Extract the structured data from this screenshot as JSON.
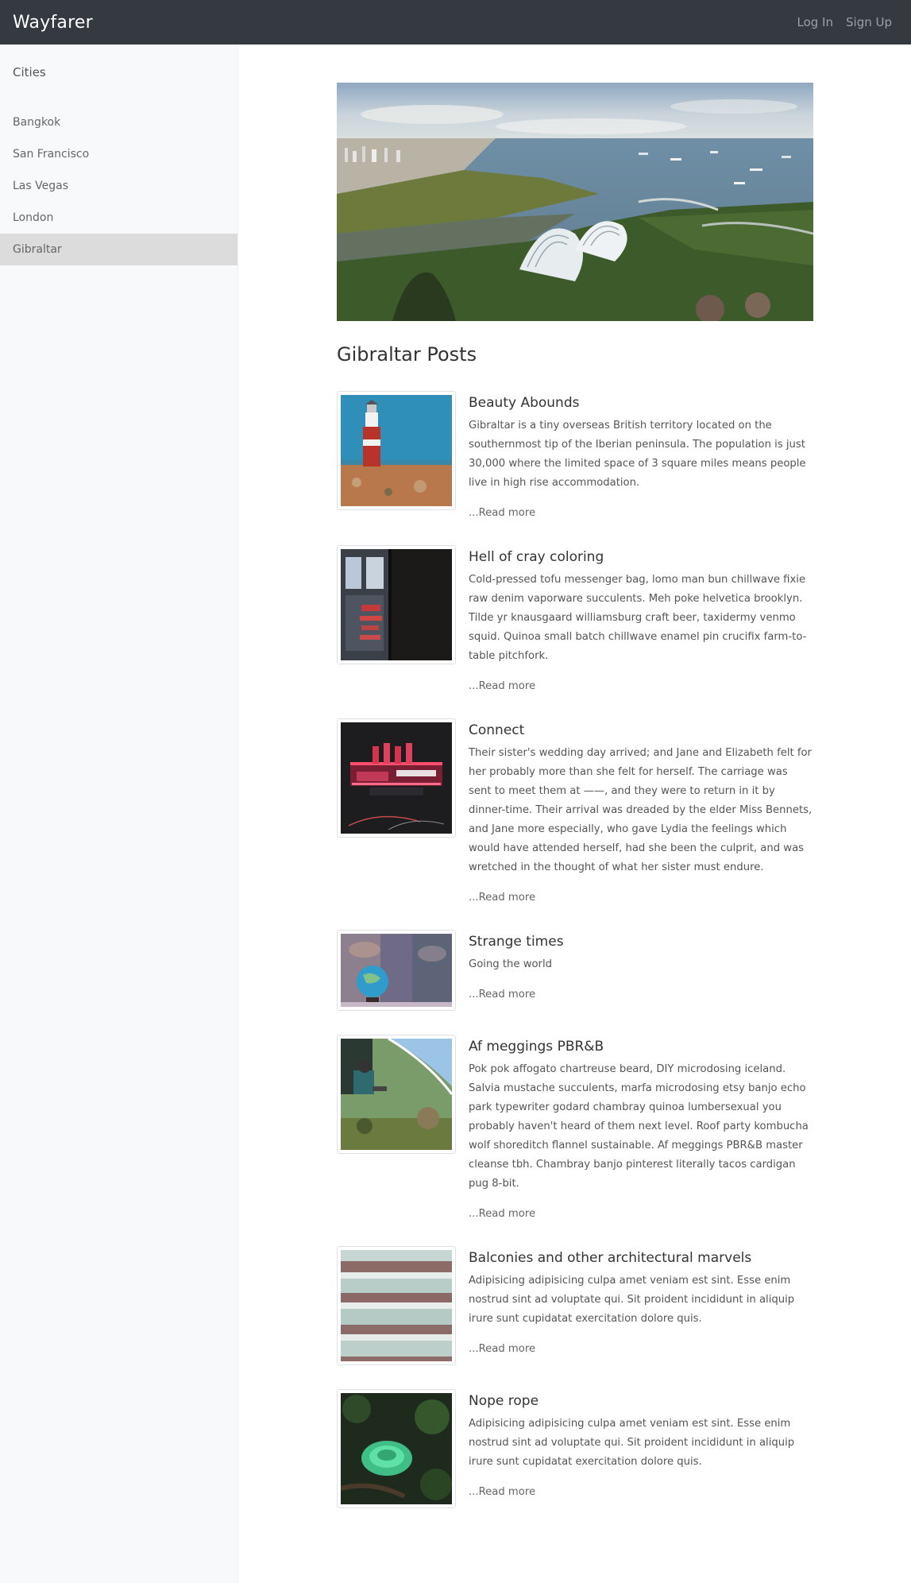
{
  "navbar": {
    "brand": "Wayfarer",
    "login_label": "Log In",
    "signup_label": "Sign Up"
  },
  "sidebar": {
    "title": "Cities",
    "items": [
      {
        "label": "Bangkok",
        "active": false
      },
      {
        "label": "San Francisco",
        "active": false
      },
      {
        "label": "Las Vegas",
        "active": false
      },
      {
        "label": "London",
        "active": false
      },
      {
        "label": "Gibraltar",
        "active": true
      }
    ]
  },
  "main": {
    "section_title": "Gibraltar Posts",
    "read_more_label": "...Read more",
    "posts": [
      {
        "title": "Beauty Abounds",
        "body": "Gibraltar is a tiny overseas British territory located on the southernmost tip of the Iberian peninsula. The population is just 30,000 where the limited space of 3 square miles means people live in high rise accommodation.",
        "read_more": "...Read more",
        "image": "lighthouse"
      },
      {
        "title": "Hell of cray coloring",
        "body": "Cold-pressed tofu messenger bag, lomo man bun chillwave fixie raw denim vaporware succulents. Meh poke helvetica brooklyn. Tilde yr knausgaard williamsburg craft beer, taxidermy venmo squid. Quinoa small batch chillwave enamel pin crucifix farm-to-table pitchfork.",
        "read_more": "...Read more",
        "image": "storefront"
      },
      {
        "title": "Connect",
        "body": "Their sister's wedding day arrived; and Jane and Elizabeth felt for her probably more than she felt for herself. The carriage was sent to meet them at ——, and they were to return in it by dinner-time. Their arrival was dreaded by the elder Miss Bennets, and Jane more especially, who gave Lydia the feelings which would have attended herself, had she been the culprit, and was wretched in the thought of what her sister must endure.",
        "read_more": "...Read more",
        "image": "theater"
      },
      {
        "title": "Strange times",
        "body": "Going the world",
        "read_more": "...Read more",
        "image": "globe"
      },
      {
        "title": "Af meggings PBR&B",
        "body": "Pok pok affogato chartreuse beard, DIY microdosing iceland. Salvia mustache succulents, marfa microdosing etsy banjo echo park typewriter godard chambray quinoa lumbersexual you probably haven't heard of them next level. Roof party kombucha wolf shoreditch flannel sustainable. Af meggings PBR&B master cleanse tbh. Chambray banjo pinterest literally tacos cardigan pug 8-bit.",
        "read_more": "...Read more",
        "image": "skydiver"
      },
      {
        "title": "Balconies and other architectural marvels",
        "body": "Adipisicing adipisicing culpa amet veniam est sint. Esse enim nostrud sint ad voluptate qui. Sit proident incididunt in aliquip irure sunt cupidatat exercitation dolore quis.",
        "read_more": "...Read more",
        "image": "balconies"
      },
      {
        "title": "Nope rope",
        "body": "Adipisicing adipisicing culpa amet veniam est sint. Esse enim nostrud sint ad voluptate qui. Sit proident incididunt in aliquip irure sunt cupidatat exercitation dolore quis.",
        "read_more": "...Read more",
        "image": "snake"
      }
    ]
  },
  "colors": {
    "navbar_bg": "#343a40",
    "sidebar_bg": "#f8f9fb",
    "sidebar_active": "#dcdcdc"
  }
}
